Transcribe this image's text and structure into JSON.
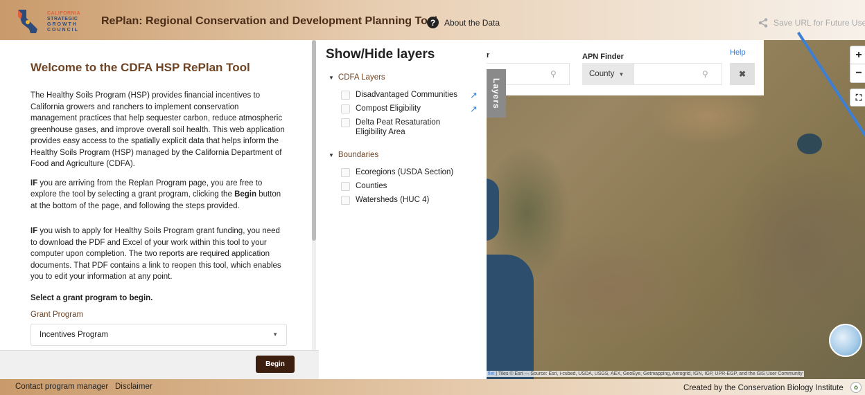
{
  "header": {
    "logo": {
      "line1": "CALIFORNIA",
      "line2": "STRATEGIC",
      "line3": "GROWTH",
      "line4": "COUNCIL"
    },
    "title": "RePlan: Regional Conservation and Development Planning Tool",
    "about_icon": "question-circle-icon",
    "about_label": "About the Data",
    "save_icon": "share-icon",
    "save_label": "Save URL for Future Use"
  },
  "left_panel": {
    "welcome": "Welcome to the CDFA HSP RePlan Tool",
    "para1": "The Healthy Soils Program (HSP) provides financial incentives to California growers and ranchers to implement conservation management practices that help sequester carbon, reduce atmospheric greenhouse gases, and improve overall soil health. This web application provides easy access to the spatially explicit data that helps inform the Healthy Soils Program (HSP) managed by the California Department of Food and Agriculture (CDFA).",
    "para2_bold": "IF",
    "para2_a": " you are arriving from the Replan Program page, you are free to explore the tool by selecting a grant program, clicking the ",
    "para2_begin": "Begin",
    "para2_b": " button at the bottom of the page, and following the steps provided.",
    "para3_bold": "IF",
    "para3": " you wish to apply for Healthy Soils Program grant funding, you need to download the PDF and Excel of your work within this tool to your computer upon completion. The two reports are required application documents. That PDF contains a link to reopen this tool, which enables you to edit your information at any point.",
    "select_prompt": "Select a grant program to begin.",
    "grant_label": "Grant Program",
    "grant_value": "Incentives Program",
    "begin_label": "Begin"
  },
  "layers": {
    "title": "Show/Hide layers",
    "tab_label": "Layers",
    "groups": [
      {
        "name": "CDFA Layers",
        "items": [
          {
            "label": "Disadvantaged Communities",
            "external": true
          },
          {
            "label": "Compost Eligibility",
            "external": true
          },
          {
            "label": "Delta Peat Resaturation Eligibility Area",
            "external": false
          }
        ]
      },
      {
        "name": "Boundaries",
        "items": [
          {
            "label": "Ecoregions (USDA Section)",
            "external": false
          },
          {
            "label": "Counties",
            "external": false
          },
          {
            "label": "Watersheds (HUC 4)",
            "external": false
          }
        ]
      }
    ]
  },
  "finder": {
    "cut_label": "r",
    "apn_title": "APN Finder",
    "help": "Help",
    "county_label": "County",
    "search_icon": "search-icon",
    "clear_icon": "close-icon"
  },
  "map": {
    "zoom_in": "+",
    "zoom_out": "−",
    "attribution_link": "flet",
    "attribution_text": " | Tiles © Esri — Source: Esri, i-cubed, USDA, USGS, AEX, GeoEye, Getmapping, Aerogrid, IGN, IGP, UPR-EGP, and the GIS User Community"
  },
  "footer": {
    "contact": "Contact program manager",
    "disclaimer": "Disclaimer",
    "created": "Created by the Conservation Biology Institute"
  },
  "colors": {
    "accent_brown": "#6e4424",
    "begin_button": "#3d1f10",
    "link_blue": "#3a7bd5"
  }
}
